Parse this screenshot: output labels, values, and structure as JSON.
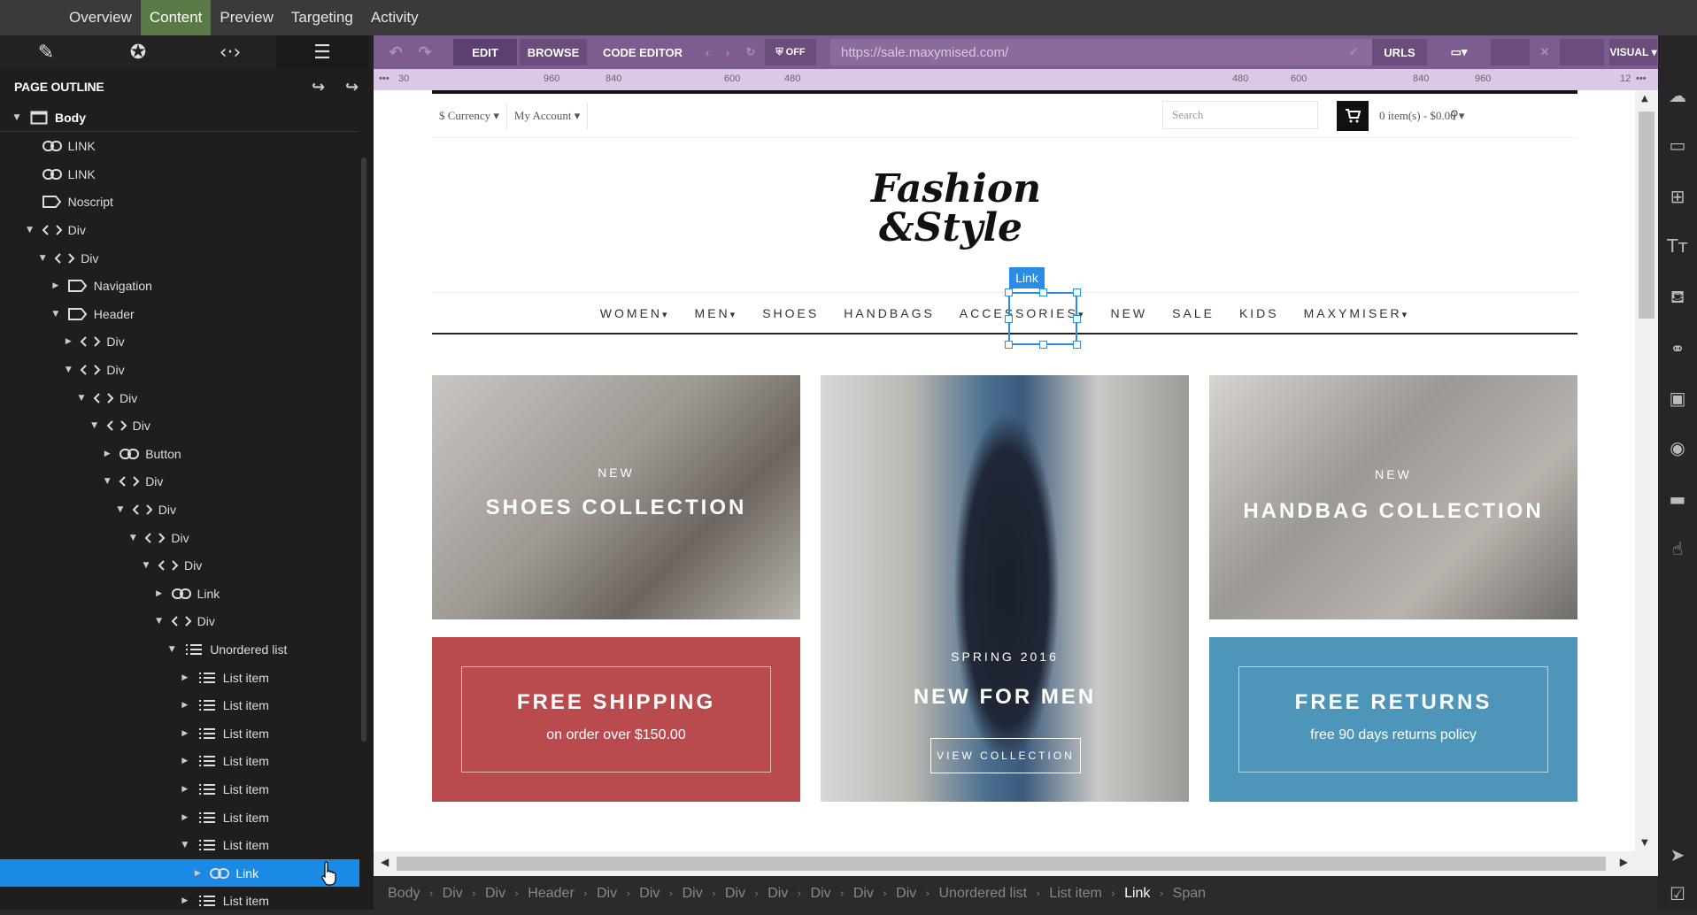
{
  "topnav": {
    "tabs": [
      "Overview",
      "Content",
      "Preview",
      "Targeting",
      "Activity"
    ],
    "active": "Content"
  },
  "sidebar": {
    "tools": [
      "pencil-icon",
      "badge-icon",
      "code-icon",
      "outline-icon"
    ],
    "outline_title": "PAGE OUTLINE",
    "rows": [
      {
        "label": "Body",
        "type": "body",
        "caret": "down",
        "indent": 0
      },
      {
        "label": "LINK",
        "type": "link",
        "caret": "",
        "indent": 1
      },
      {
        "label": "LINK",
        "type": "link",
        "caret": "",
        "indent": 1
      },
      {
        "label": "Noscript",
        "type": "tag",
        "caret": "",
        "indent": 1
      },
      {
        "label": "Div",
        "type": "code",
        "caret": "down",
        "indent": 1
      },
      {
        "label": "Div",
        "type": "code",
        "caret": "down",
        "indent": 2
      },
      {
        "label": "Navigation",
        "type": "tag",
        "caret": "right",
        "indent": 3
      },
      {
        "label": "Header",
        "type": "tag",
        "caret": "down",
        "indent": 3
      },
      {
        "label": "Div",
        "type": "code",
        "caret": "right",
        "indent": 4
      },
      {
        "label": "Div",
        "type": "code",
        "caret": "down",
        "indent": 4
      },
      {
        "label": "Div",
        "type": "code",
        "caret": "down",
        "indent": 5
      },
      {
        "label": "Div",
        "type": "code",
        "caret": "down",
        "indent": 6
      },
      {
        "label": "Button",
        "type": "link",
        "caret": "right",
        "indent": 7
      },
      {
        "label": "Div",
        "type": "code",
        "caret": "down",
        "indent": 7
      },
      {
        "label": "Div",
        "type": "code",
        "caret": "down",
        "indent": 8
      },
      {
        "label": "Div",
        "type": "code",
        "caret": "down",
        "indent": 9
      },
      {
        "label": "Div",
        "type": "code",
        "caret": "down",
        "indent": 10
      },
      {
        "label": "Link",
        "type": "link",
        "caret": "right",
        "indent": 11
      },
      {
        "label": "Div",
        "type": "code",
        "caret": "down",
        "indent": 11
      },
      {
        "label": "Unordered list",
        "type": "list",
        "caret": "down",
        "indent": 12
      },
      {
        "label": "List item",
        "type": "list",
        "caret": "right",
        "indent": 13
      },
      {
        "label": "List item",
        "type": "list",
        "caret": "right",
        "indent": 13
      },
      {
        "label": "List item",
        "type": "list",
        "caret": "right",
        "indent": 13
      },
      {
        "label": "List item",
        "type": "list",
        "caret": "right",
        "indent": 13
      },
      {
        "label": "List item",
        "type": "list",
        "caret": "right",
        "indent": 13
      },
      {
        "label": "List item",
        "type": "list",
        "caret": "right",
        "indent": 13
      },
      {
        "label": "List item",
        "type": "list",
        "caret": "down",
        "indent": 13
      },
      {
        "label": "Link",
        "type": "link",
        "caret": "right",
        "indent": 14,
        "selected": true
      },
      {
        "label": "List item",
        "type": "list",
        "caret": "right",
        "indent": 13
      }
    ]
  },
  "toolbar": {
    "edit": "EDIT",
    "browse": "BROWSE",
    "code_editor": "CODE EDITOR",
    "off": "OFF",
    "url": "https://sale.maxymised.com/",
    "urls": "URLS",
    "visual": "VISUAL"
  },
  "ruler": {
    "labels": [
      "30",
      "960",
      "840",
      "600",
      "480",
      "480",
      "600",
      "840",
      "960",
      "12"
    ]
  },
  "site": {
    "currency": "$ Currency",
    "account": "My Account",
    "search_placeholder": "Search",
    "cart": "0 item(s) - $0.00",
    "logo_line1": "Fashion",
    "logo_line2": "&Style",
    "nav": [
      "WOMEN",
      "MEN",
      "SHOES",
      "HANDBAGS",
      "ACCESSORIES",
      "NEW",
      "SALE",
      "KIDS",
      "MAXYMISER"
    ],
    "selection_tag": "Link",
    "tile1_kicker": "NEW",
    "tile1_title": "SHOES COLLECTION",
    "tile2_kicker": "SPRING 2016",
    "tile2_title": "NEW FOR MEN",
    "tile2_button": "VIEW COLLECTION",
    "tile3_kicker": "NEW",
    "tile3_title": "HANDBAG COLLECTION",
    "tile4_title": "FREE SHIPPING",
    "tile4_sub": "on order over $150.00",
    "tile5_title": "FREE RETURNS",
    "tile5_sub": "free 90 days returns policy"
  },
  "breadcrumb": [
    "Body",
    "Div",
    "Div",
    "Header",
    "Div",
    "Div",
    "Div",
    "Div",
    "Div",
    "Div",
    "Div",
    "Div",
    "Unordered list",
    "List item",
    "Link",
    "Span"
  ],
  "colors": {
    "toolbar": "#7d5d8f",
    "accent": "#1a8ae6",
    "shipping": "#b94a4d",
    "returns": "#4e96b9"
  }
}
